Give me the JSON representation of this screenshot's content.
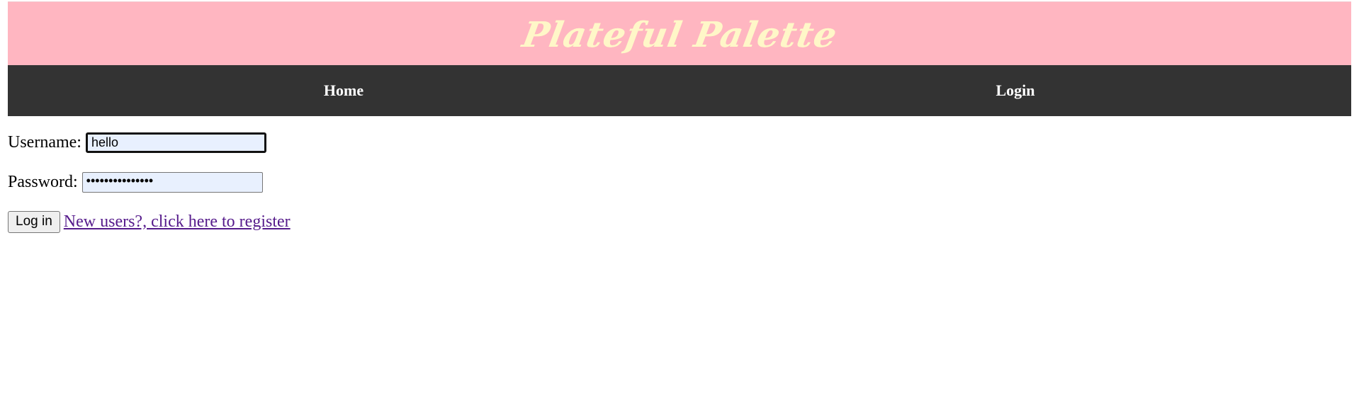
{
  "header": {
    "title": "Plateful Palette"
  },
  "nav": {
    "items": [
      {
        "label": "Home"
      },
      {
        "label": "Login"
      }
    ]
  },
  "login_form": {
    "username_label": "Username:",
    "username_value": "hello",
    "password_label": "Password:",
    "password_value": "•••••••••••••••",
    "submit_label": "Log in",
    "register_link": "New users?, click here to register"
  },
  "colors": {
    "header_bg": "#ffb6c1",
    "title_text": "#fff7c8",
    "nav_bg": "#333333",
    "autofill_bg": "#e8f0fe",
    "visited_link": "#551a8b"
  }
}
